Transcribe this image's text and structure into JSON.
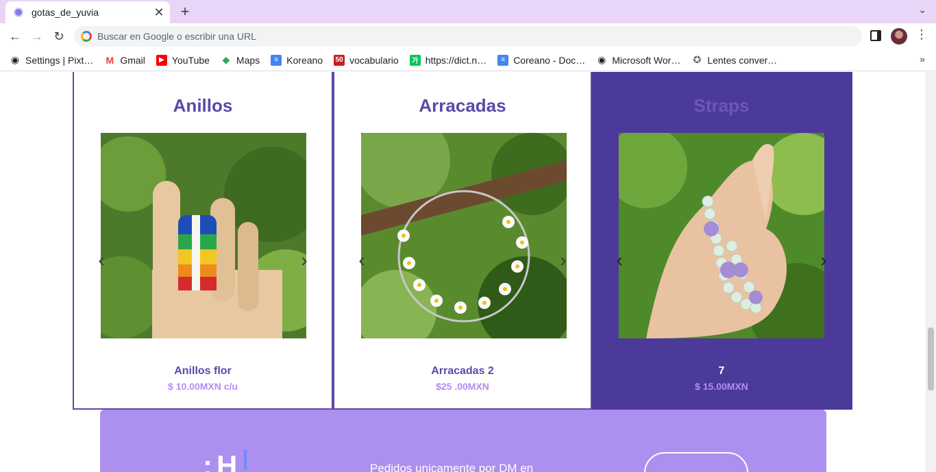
{
  "browser": {
    "tab": {
      "title": "gotas_de_yuvia"
    },
    "omnibox": {
      "placeholder": "Buscar en Google o escribir una URL"
    },
    "bookmarks": [
      {
        "label": "Settings | Pixt…",
        "icon": "globe-icon",
        "color": "#202124"
      },
      {
        "label": "Gmail",
        "icon": "gmail-icon",
        "color": "#ea4335"
      },
      {
        "label": "YouTube",
        "icon": "youtube-icon",
        "color": "#ff0000"
      },
      {
        "label": "Maps",
        "icon": "maps-icon",
        "color": "#34a853"
      },
      {
        "label": "Koreano",
        "icon": "docs-icon",
        "color": "#4285f4"
      },
      {
        "label": "vocabulario",
        "icon": "fifty-icon",
        "color": "#c5221f"
      },
      {
        "label": "https://dict.n…",
        "icon": "naver-icon",
        "color": "#03c75a"
      },
      {
        "label": "Coreano - Doc…",
        "icon": "docs-icon",
        "color": "#4285f4"
      },
      {
        "label": "Microsoft Wor…",
        "icon": "globe-icon",
        "color": "#202124"
      },
      {
        "label": "Lentes conver…",
        "icon": "puzzle-icon",
        "color": "#5f6368"
      }
    ]
  },
  "categories": [
    {
      "title": "Anillos",
      "product": "Anillos flor",
      "price": "$ 10.00MXN c/u"
    },
    {
      "title": "Arracadas",
      "product": "Arracadas 2",
      "price": "$25 .00MXN"
    },
    {
      "title": "Straps",
      "product": "7",
      "price": "$ 15.00MXN"
    }
  ],
  "footer": {
    "text": "Pedidos unicamente por DM en"
  },
  "colors": {
    "accent": "#5d48a8",
    "active_card": "#4b3a99",
    "price": "#b48cf0",
    "footer": "#ad8ff0"
  }
}
